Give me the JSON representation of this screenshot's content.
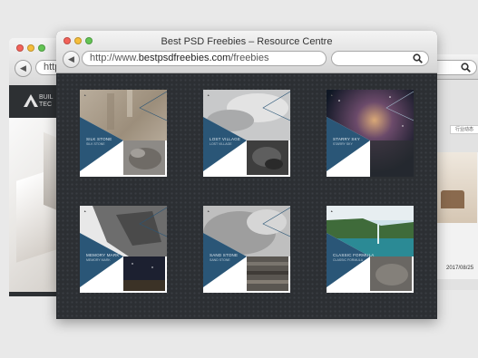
{
  "window": {
    "title": "Best PSD Freebies – Resource Centre",
    "url_prefix": "http://www.",
    "url_domain": "bestpsdfreebies.com",
    "url_path": "/freebies",
    "search_placeholder": ""
  },
  "left_window": {
    "url": "http:",
    "brand_name": "BUIL\nTEC"
  },
  "right_window": {
    "tag_label": "行业动态",
    "date": "2017/08/25"
  },
  "cards": [
    {
      "caption": "SILK STONE",
      "sub": "SILK STONE"
    },
    {
      "caption": "LOST VILLAGE",
      "sub": "LOST VILLAGE"
    },
    {
      "caption": "STARRY SKY",
      "sub": "STARRY SKY"
    },
    {
      "caption": "MEMORY MARK",
      "sub": "MEMORY MARK"
    },
    {
      "caption": "SAND STONE",
      "sub": "SAND STONE"
    },
    {
      "caption": "CLASSIC FORMULA",
      "sub": "CLASSIC FORMULA"
    }
  ],
  "icons": {
    "back": "back-arrow-icon",
    "search": "search-icon",
    "brand": "triangle-logo-icon"
  },
  "colors": {
    "accent_blue": "#2a5677",
    "page_bg": "#2c2f33"
  }
}
